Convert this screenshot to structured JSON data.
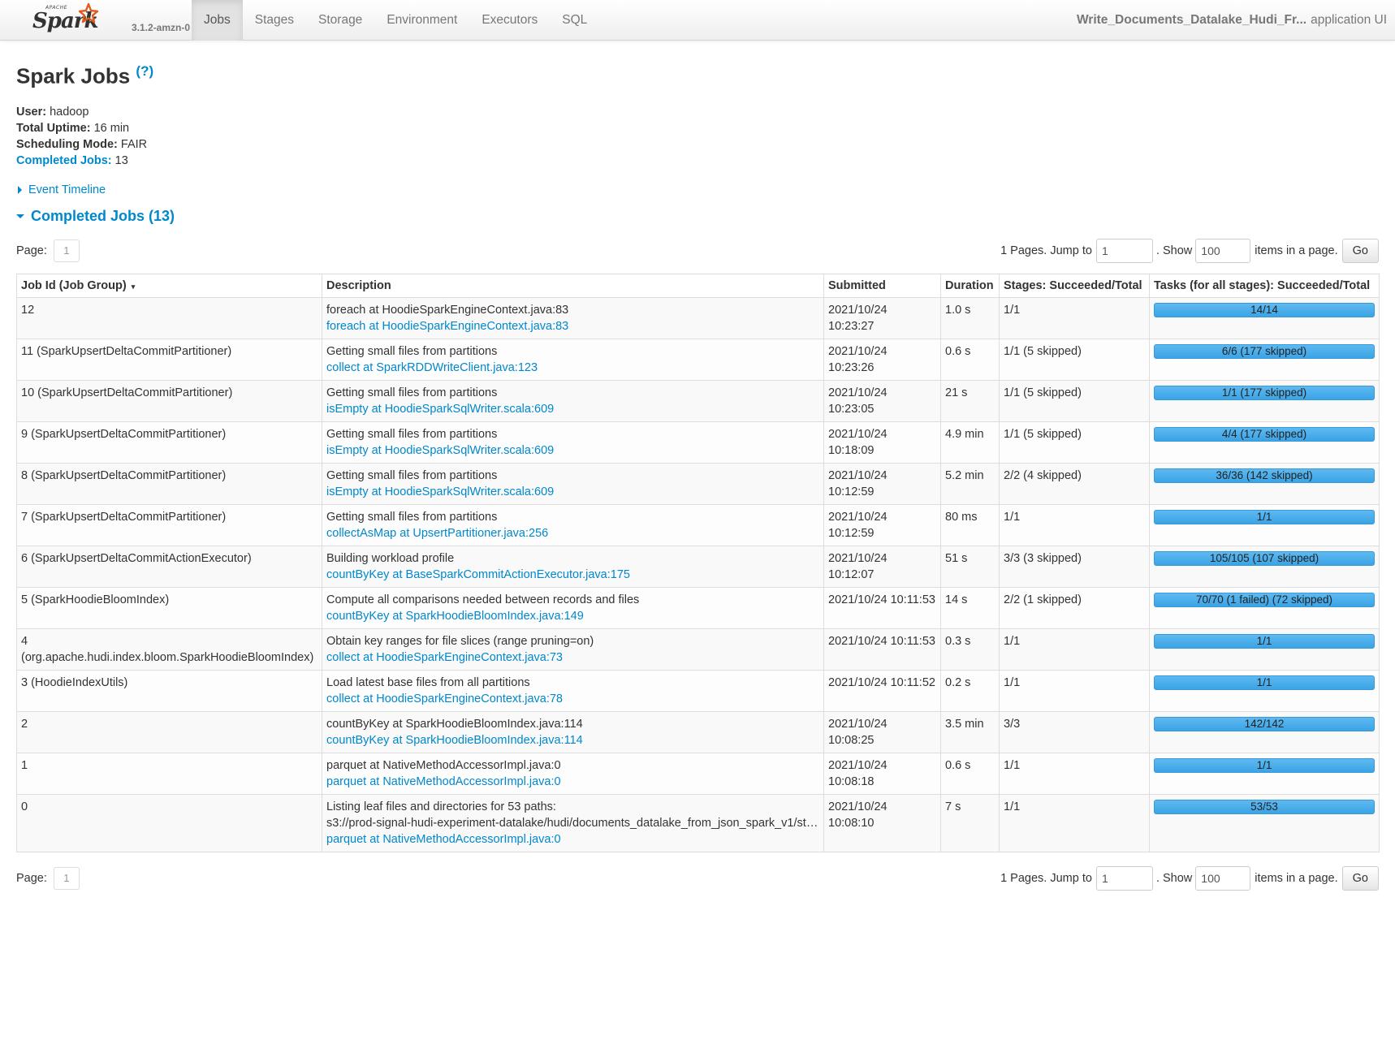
{
  "brand": {
    "apache": "APACHE",
    "spark": "Spark",
    "version": "3.1.2-amzn-0"
  },
  "nav": {
    "tabs": [
      {
        "label": "Jobs",
        "active": true
      },
      {
        "label": "Stages"
      },
      {
        "label": "Storage"
      },
      {
        "label": "Environment"
      },
      {
        "label": "Executors"
      },
      {
        "label": "SQL"
      }
    ],
    "app_name": "Write_Documents_Datalake_Hudi_Fr...",
    "app_suffix": "application UI"
  },
  "page": {
    "title": "Spark Jobs",
    "help": "(?)",
    "summary": {
      "user_label": "User:",
      "user": "hadoop",
      "uptime_label": "Total Uptime:",
      "uptime": "16 min",
      "sched_label": "Scheduling Mode:",
      "sched": "FAIR",
      "completed_label": "Completed Jobs:",
      "completed": "13"
    },
    "event_timeline": "Event Timeline",
    "completed_section": "Completed Jobs (13)"
  },
  "paging": {
    "page_label": "Page:",
    "current_page": "1",
    "pages_text": "1 Pages. Jump to",
    "jump_value": "1",
    "show_text": ". Show",
    "show_value": "100",
    "items_text": "items in a page.",
    "go": "Go"
  },
  "table": {
    "headers": [
      "Job Id (Job Group)",
      "Description",
      "Submitted",
      "Duration",
      "Stages: Succeeded/Total",
      "Tasks (for all stages): Succeeded/Total"
    ],
    "sort_indicator": "▾",
    "rows": [
      {
        "id": "12",
        "desc": "foreach at HoodieSparkEngineContext.java:83",
        "link": "foreach at HoodieSparkEngineContext.java:83",
        "submitted": "2021/10/24 10:23:27",
        "duration": "1.0 s",
        "stages": "1/1",
        "tasks": "14/14",
        "progress": 1.0
      },
      {
        "id": "11 (SparkUpsertDeltaCommitPartitioner)",
        "desc": "Getting small files from partitions",
        "link": "collect at SparkRDDWriteClient.java:123",
        "submitted": "2021/10/24 10:23:26",
        "duration": "0.6 s",
        "stages": "1/1 (5 skipped)",
        "tasks": "6/6 (177 skipped)",
        "progress": 1.0
      },
      {
        "id": "10 (SparkUpsertDeltaCommitPartitioner)",
        "desc": "Getting small files from partitions",
        "link": "isEmpty at HoodieSparkSqlWriter.scala:609",
        "submitted": "2021/10/24 10:23:05",
        "duration": "21 s",
        "stages": "1/1 (5 skipped)",
        "tasks": "1/1 (177 skipped)",
        "progress": 1.0
      },
      {
        "id": "9 (SparkUpsertDeltaCommitPartitioner)",
        "desc": "Getting small files from partitions",
        "link": "isEmpty at HoodieSparkSqlWriter.scala:609",
        "submitted": "2021/10/24 10:18:09",
        "duration": "4.9 min",
        "stages": "1/1 (5 skipped)",
        "tasks": "4/4 (177 skipped)",
        "progress": 1.0
      },
      {
        "id": "8 (SparkUpsertDeltaCommitPartitioner)",
        "desc": "Getting small files from partitions",
        "link": "isEmpty at HoodieSparkSqlWriter.scala:609",
        "submitted": "2021/10/24 10:12:59",
        "duration": "5.2 min",
        "stages": "2/2 (4 skipped)",
        "tasks": "36/36 (142 skipped)",
        "progress": 1.0
      },
      {
        "id": "7 (SparkUpsertDeltaCommitPartitioner)",
        "desc": "Getting small files from partitions",
        "link": "collectAsMap at UpsertPartitioner.java:256",
        "submitted": "2021/10/24 10:12:59",
        "duration": "80 ms",
        "stages": "1/1",
        "tasks": "1/1",
        "progress": 1.0
      },
      {
        "id": "6 (SparkUpsertDeltaCommitActionExecutor)",
        "desc": "Building workload profile",
        "link": "countByKey at BaseSparkCommitActionExecutor.java:175",
        "submitted": "2021/10/24 10:12:07",
        "duration": "51 s",
        "stages": "3/3 (3 skipped)",
        "tasks": "105/105 (107 skipped)",
        "progress": 1.0
      },
      {
        "id": "5 (SparkHoodieBloomIndex)",
        "desc": "Compute all comparisons needed between records and files",
        "link": "countByKey at SparkHoodieBloomIndex.java:149",
        "submitted": "2021/10/24 10:11:53",
        "duration": "14 s",
        "stages": "2/2 (1 skipped)",
        "tasks": "70/70 (1 failed) (72 skipped)",
        "progress": 1.0
      },
      {
        "id": "4 (org.apache.hudi.index.bloom.SparkHoodieBloomIndex)",
        "desc": "Obtain key ranges for file slices (range pruning=on)",
        "link": "collect at HoodieSparkEngineContext.java:73",
        "submitted": "2021/10/24 10:11:53",
        "duration": "0.3 s",
        "stages": "1/1",
        "tasks": "1/1",
        "progress": 1.0
      },
      {
        "id": "3 (HoodieIndexUtils)",
        "desc": "Load latest base files from all partitions",
        "link": "collect at HoodieSparkEngineContext.java:78",
        "submitted": "2021/10/24 10:11:52",
        "duration": "0.2 s",
        "stages": "1/1",
        "tasks": "1/1",
        "progress": 1.0
      },
      {
        "id": "2",
        "desc": "countByKey at SparkHoodieBloomIndex.java:114",
        "link": "countByKey at SparkHoodieBloomIndex.java:114",
        "submitted": "2021/10/24 10:08:25",
        "duration": "3.5 min",
        "stages": "3/3",
        "tasks": "142/142",
        "progress": 1.0
      },
      {
        "id": "1",
        "desc": "parquet at NativeMethodAccessorImpl.java:0",
        "link": "parquet at NativeMethodAccessorImpl.java:0",
        "submitted": "2021/10/24 10:08:18",
        "duration": "0.6 s",
        "stages": "1/1",
        "tasks": "1/1",
        "progress": 1.0
      },
      {
        "id": "0",
        "desc": "Listing leaf files and directories for 53 paths:",
        "desc2": "s3://prod-signal-hudi-experiment-datalake/hudi/documents_datalake_from_json_spark_v1/sto...",
        "link": "parquet at NativeMethodAccessorImpl.java:0",
        "submitted": "2021/10/24 10:08:10",
        "duration": "7 s",
        "stages": "1/1",
        "tasks": "53/53",
        "progress": 1.0
      }
    ]
  }
}
